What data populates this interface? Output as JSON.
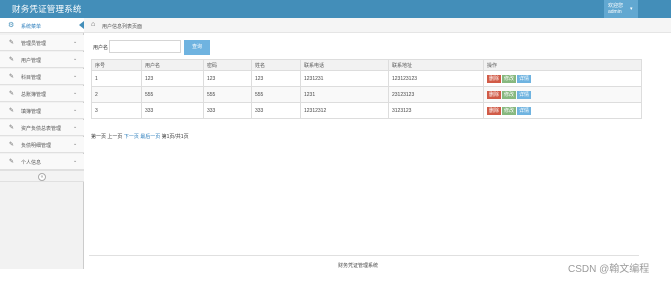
{
  "app": {
    "title": "财务凭证管理系统",
    "user": {
      "welcome": "欢迎您",
      "name": "admin",
      "caret": "▾"
    }
  },
  "sidebar": {
    "header": "系统菜单",
    "items": [
      {
        "label": "管理员管理"
      },
      {
        "label": "用户管理"
      },
      {
        "label": "科目管理"
      },
      {
        "label": "总账簿管理"
      },
      {
        "label": "填簿管理"
      },
      {
        "label": "资产负债总表管理"
      },
      {
        "label": "负债明细管理"
      },
      {
        "label": "个人信息"
      }
    ],
    "collapse_glyph": "«"
  },
  "breadcrumb": {
    "text": "用户信息列表页面"
  },
  "search": {
    "label": "用户名",
    "value": "",
    "placeholder": "",
    "button": "查询"
  },
  "table": {
    "headers": [
      "序号",
      "用户名",
      "密码",
      "姓名",
      "联系电话",
      "联系地址",
      "操作"
    ],
    "rows": [
      {
        "id": "1",
        "username": "123",
        "password": "123",
        "name": "123",
        "phone": "1231231",
        "address": "123123123"
      },
      {
        "id": "2",
        "username": "555",
        "password": "555",
        "name": "555",
        "phone": "1231",
        "address": "23123123"
      },
      {
        "id": "3",
        "username": "333",
        "password": "333",
        "name": "333",
        "phone": "12312312",
        "address": "3123123"
      }
    ],
    "actions": {
      "delete": "删除",
      "edit": "修改",
      "detail": "详情"
    }
  },
  "pagination": {
    "first": "第一页",
    "prev": "上一页",
    "next": "下一页",
    "last": "最后一页",
    "info": "第1页/共1页"
  },
  "footer": {
    "text": "财务凭证管理系统"
  },
  "watermark": {
    "text": "CSDN @翰文编程"
  },
  "colors": {
    "topbar": "#438eb9",
    "user_box": "#62a8d1",
    "search_button": "#6fb3e0",
    "delete_button": "#d15b47",
    "edit_button": "#87b87f",
    "detail_button": "#6fb3e0",
    "link": "#2b7dbc"
  },
  "icons": {
    "menu_header": "dashboard-icon",
    "menu_item": "edit-icon",
    "breadcrumb": "home-icon",
    "expand": "chevron-down-icon"
  }
}
